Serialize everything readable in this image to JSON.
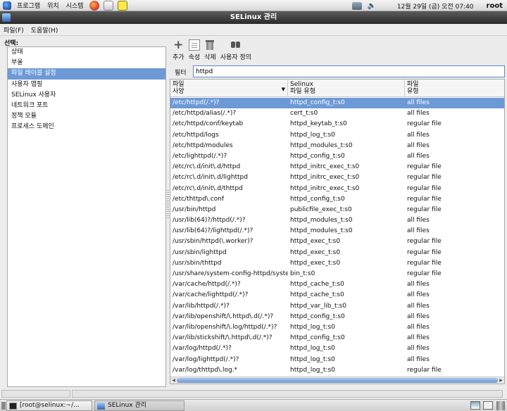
{
  "panel": {
    "menus": [
      "프로그램",
      "위치",
      "시스템"
    ],
    "launchers": [
      "firefox-icon",
      "mail-icon",
      "notes-icon"
    ],
    "clock": "12월 29일 (금) 오전 07:40",
    "user": "root"
  },
  "window": {
    "title": "SELinux 관리"
  },
  "menubar": {
    "file": "파일(F)",
    "help": "도움말(H)"
  },
  "sidebar": {
    "label": "선택:",
    "items": [
      {
        "label": "상태"
      },
      {
        "label": "부울"
      },
      {
        "label": "파일 레이블 설정"
      },
      {
        "label": "사용자 맵핑"
      },
      {
        "label": "SELinux 사용자"
      },
      {
        "label": "네트워크 포트"
      },
      {
        "label": "정책 모듈"
      },
      {
        "label": "프로세스 도메인"
      }
    ],
    "selected_index": 2
  },
  "toolbar": {
    "add": "추가",
    "properties": "속성",
    "delete": "삭제",
    "customized": "사용자 정의"
  },
  "filter": {
    "label": "필터",
    "value": "httpd"
  },
  "table": {
    "headers": {
      "spec_line1": "파일",
      "spec_line2": "사양",
      "type_line1": "Selinux",
      "type_line2": "파일 유형",
      "class_line1": "파일",
      "class_line2": "유형"
    },
    "rows": [
      {
        "spec": "/etc/httpd(/.*)?",
        "type": "httpd_config_t:s0",
        "class": "all files"
      },
      {
        "spec": "/etc/httpd/alias(/.*)?",
        "type": "cert_t:s0",
        "class": "all files"
      },
      {
        "spec": "/etc/httpd/conf/keytab",
        "type": "httpd_keytab_t:s0",
        "class": "regular file"
      },
      {
        "spec": "/etc/httpd/logs",
        "type": "httpd_log_t:s0",
        "class": "all files"
      },
      {
        "spec": "/etc/httpd/modules",
        "type": "httpd_modules_t:s0",
        "class": "all files"
      },
      {
        "spec": "/etc/lighttpd(/.*)?",
        "type": "httpd_config_t:s0",
        "class": "all files"
      },
      {
        "spec": "/etc/rc\\.d/init\\.d/httpd",
        "type": "httpd_initrc_exec_t:s0",
        "class": "regular file"
      },
      {
        "spec": "/etc/rc\\.d/init\\.d/lighttpd",
        "type": "httpd_initrc_exec_t:s0",
        "class": "regular file"
      },
      {
        "spec": "/etc/rc\\.d/init\\.d/thttpd",
        "type": "httpd_initrc_exec_t:s0",
        "class": "regular file"
      },
      {
        "spec": "/etc/thttpd\\.conf",
        "type": "httpd_config_t:s0",
        "class": "regular file"
      },
      {
        "spec": "/usr/bin/httpd",
        "type": "publicfile_exec_t:s0",
        "class": "regular file"
      },
      {
        "spec": "/usr/lib(64)?/httpd(/.*)?",
        "type": "httpd_modules_t:s0",
        "class": "all files"
      },
      {
        "spec": "/usr/lib(64)?/lighttpd(/.*)?",
        "type": "httpd_modules_t:s0",
        "class": "all files"
      },
      {
        "spec": "/usr/sbin/httpd(\\.worker)?",
        "type": "httpd_exec_t:s0",
        "class": "regular file"
      },
      {
        "spec": "/usr/sbin/lighttpd",
        "type": "httpd_exec_t:s0",
        "class": "regular file"
      },
      {
        "spec": "/usr/sbin/thttpd",
        "type": "httpd_exec_t:s0",
        "class": "regular file"
      },
      {
        "spec": "/usr/share/system-config-httpd/syste",
        "type": "bin_t:s0",
        "class": "regular file"
      },
      {
        "spec": "/var/cache/httpd(/.*)?",
        "type": "httpd_cache_t:s0",
        "class": "all files"
      },
      {
        "spec": "/var/cache/lighttpd(/.*)?",
        "type": "httpd_cache_t:s0",
        "class": "all files"
      },
      {
        "spec": "/var/lib/httpd(/.*)?",
        "type": "httpd_var_lib_t:s0",
        "class": "all files"
      },
      {
        "spec": "/var/lib/openshift/\\.httpd\\.d(/.*)?",
        "type": "httpd_config_t:s0",
        "class": "all files"
      },
      {
        "spec": "/var/lib/openshift/\\.log/httpd(/.*)?",
        "type": "httpd_log_t:s0",
        "class": "all files"
      },
      {
        "spec": "/var/lib/stickshift/\\.httpd\\.d(/.*)?",
        "type": "httpd_config_t:s0",
        "class": "all files"
      },
      {
        "spec": "/var/log/httpd(/.*)?",
        "type": "httpd_log_t:s0",
        "class": "all files"
      },
      {
        "spec": "/var/log/lighttpd(/.*)?",
        "type": "httpd_log_t:s0",
        "class": "all files"
      },
      {
        "spec": "/var/log/thttpd\\.log.*",
        "type": "httpd_log_t:s0",
        "class": "regular file"
      }
    ],
    "selected_index": 0
  },
  "taskbar": {
    "tasks": [
      {
        "label": "[root@selinux:~/..."
      },
      {
        "label": "SELinux 관리"
      }
    ]
  },
  "colors": {
    "selection": "#6d9ad6",
    "titlebar": "#2a2a2a"
  }
}
